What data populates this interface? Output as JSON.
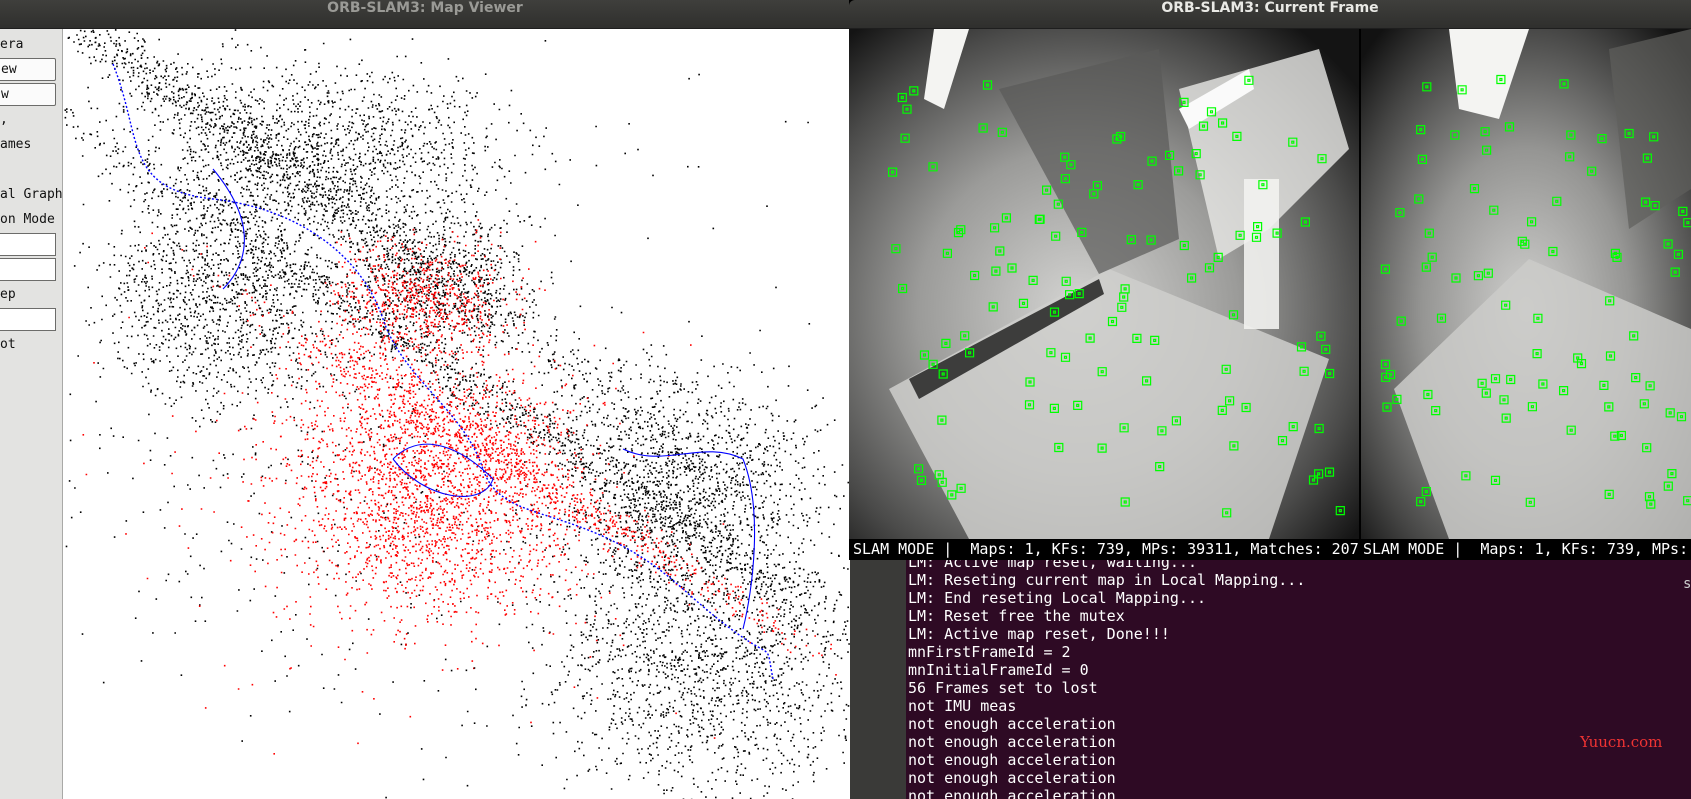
{
  "map_viewer": {
    "title": "ORB-SLAM3: Map Viewer",
    "panel_items": [
      {
        "type": "text",
        "label": "era"
      },
      {
        "type": "button",
        "label": "ew"
      },
      {
        "type": "button",
        "label": "w"
      },
      {
        "type": "text",
        "label": ","
      },
      {
        "type": "text",
        "label": "ames"
      },
      {
        "type": "text",
        "label": ""
      },
      {
        "type": "text",
        "label": "al Graph"
      },
      {
        "type": "text",
        "label": "on Mode"
      },
      {
        "type": "field",
        "label": ""
      },
      {
        "type": "field",
        "label": ""
      },
      {
        "type": "text",
        "label": "ep"
      },
      {
        "type": "field",
        "label": ""
      },
      {
        "type": "text",
        "label": "ot"
      }
    ],
    "colors": {
      "background": "#ffffff",
      "map_points": "#000000",
      "local_map_points": "#ff0000",
      "keyframe_trajectory": "#0000ff"
    }
  },
  "current_frame": {
    "title": "ORB-SLAM3: Current Frame",
    "status_left": "SLAM MODE |  Maps: 1, KFs: 739, MPs: 39311, Matches: 207",
    "status_right": "SLAM MODE |  Maps: 1, KFs: 739, MPs:",
    "colors": {
      "feature_box": "#00ff00"
    }
  },
  "terminal": {
    "lines": [
      "LM: Active map reset, waiting...",
      "LM: Reseting current map in Local Mapping...",
      "LM: End reseting Local Mapping...",
      "LM: Reset free the mutex",
      "LM: Active map reset, Done!!!",
      "mnFirstFrameId = 2",
      "mnInitialFrameId = 0",
      "56 Frames set to lost",
      "not IMU meas",
      "not enough acceleration",
      "not enough acceleration",
      "not enough acceleration",
      "not enough acceleration",
      "not enough acceleration"
    ],
    "edge_glyph": "s",
    "background": "#2e0a24"
  },
  "watermark": "Yuucn.com"
}
